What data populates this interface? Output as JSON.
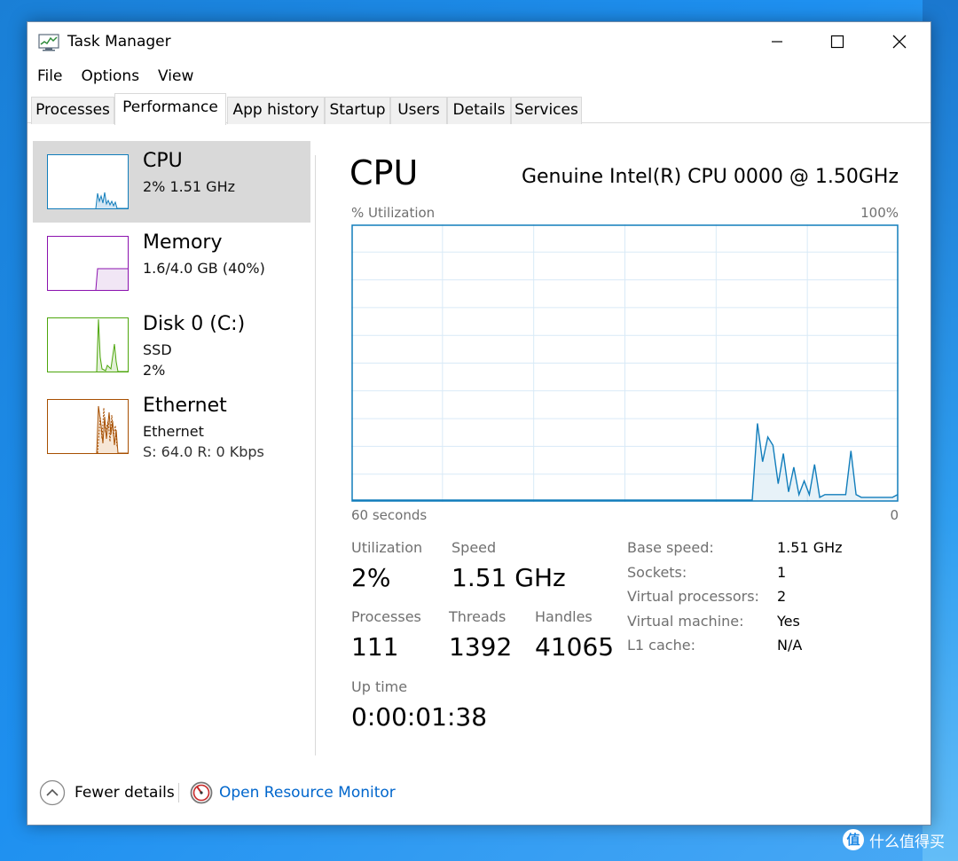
{
  "window": {
    "title": "Task Manager",
    "controls": {
      "minimize": "minimize",
      "maximize": "maximize",
      "close": "close"
    }
  },
  "menu": [
    "File",
    "Options",
    "View"
  ],
  "tabs": [
    {
      "label": "Processes",
      "active": false
    },
    {
      "label": "Performance",
      "active": true
    },
    {
      "label": "App history",
      "active": false
    },
    {
      "label": "Startup",
      "active": false
    },
    {
      "label": "Users",
      "active": false
    },
    {
      "label": "Details",
      "active": false
    },
    {
      "label": "Services",
      "active": false
    }
  ],
  "resources": [
    {
      "name": "CPU",
      "lines": [
        "2% 1.51 GHz"
      ],
      "color": "#117dbb",
      "selected": true
    },
    {
      "name": "Memory",
      "lines": [
        "1.6/4.0 GB (40%)"
      ],
      "color": "#8b12ae",
      "selected": false
    },
    {
      "name": "Disk 0 (C:)",
      "lines": [
        "SSD",
        "2%"
      ],
      "color": "#4da60c",
      "selected": false
    },
    {
      "name": "Ethernet",
      "lines": [
        "Ethernet",
        "S: 64.0  R: 0 Kbps"
      ],
      "color": "#a74f01",
      "selected": false
    }
  ],
  "detail": {
    "title": "CPU",
    "model": "Genuine Intel(R) CPU 0000 @ 1.50GHz",
    "graph_y_label": "% Utilization",
    "graph_y_max_label": "100%",
    "graph_x_left_label": "60 seconds",
    "graph_x_right_label": "0",
    "graph_color": "#117dbb",
    "graph_grid_color": "#d9eaf7",
    "utilization_samples": [
      0,
      0,
      0,
      0,
      0,
      0,
      0,
      0,
      0,
      0,
      0,
      0,
      0,
      0,
      0,
      0,
      0,
      0,
      0,
      0,
      0,
      0,
      0,
      0,
      0,
      0,
      0,
      0,
      0,
      0,
      0,
      0,
      0,
      0,
      0,
      0,
      0,
      0,
      0,
      0,
      0,
      0,
      0,
      0,
      0,
      0,
      0,
      0,
      0,
      0,
      0,
      0,
      0,
      0,
      0,
      0,
      0,
      0,
      0,
      0,
      0,
      0,
      0,
      0,
      0,
      0,
      0,
      0,
      0,
      0,
      0,
      0,
      0,
      0,
      0,
      0,
      0,
      0,
      28,
      14,
      23,
      20,
      6,
      17,
      3,
      12,
      2,
      7,
      2,
      13,
      1,
      2,
      2,
      2,
      2,
      2,
      18,
      2,
      1,
      1,
      1,
      1,
      1,
      1,
      1,
      2
    ],
    "stats": [
      {
        "label": "Utilization",
        "value": "2%"
      },
      {
        "label": "Speed",
        "value": "1.51 GHz"
      },
      {
        "label": "Processes",
        "value": "111"
      },
      {
        "label": "Threads",
        "value": "1392"
      },
      {
        "label": "Handles",
        "value": "41065"
      },
      {
        "label": "Up time",
        "value": "0:00:01:38"
      }
    ],
    "specs": [
      {
        "label": "Base speed:",
        "value": "1.51 GHz"
      },
      {
        "label": "Sockets:",
        "value": "1"
      },
      {
        "label": "Virtual processors:",
        "value": "2"
      },
      {
        "label": "Virtual machine:",
        "value": "Yes"
      },
      {
        "label": "L1 cache:",
        "value": "N/A"
      }
    ]
  },
  "footer": {
    "fewer_details": "Fewer details",
    "open_resource_monitor": "Open Resource Monitor"
  },
  "watermark": {
    "logo_glyph": "值",
    "text": "什么值得买"
  }
}
